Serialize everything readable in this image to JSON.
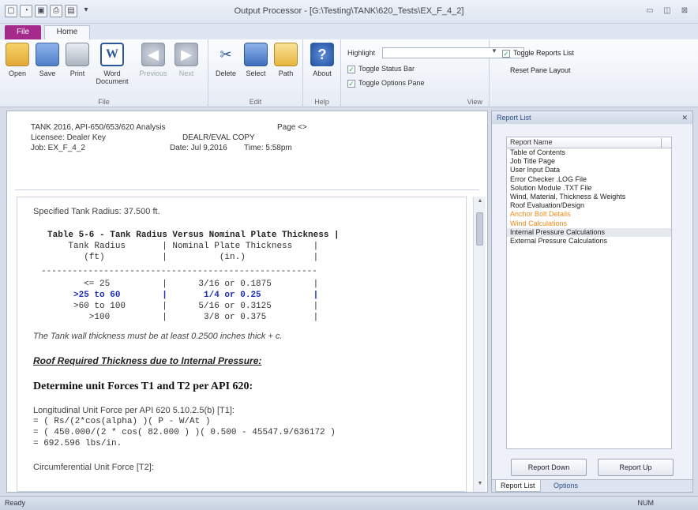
{
  "window": {
    "title": "Output Processor - [G:\\Testing\\TANK\\620_Tests\\EX_F_4_2]"
  },
  "ribbon": {
    "tabs": [
      "File",
      "Home"
    ],
    "file_group": {
      "label": "File",
      "buttons": [
        "Open",
        "Save",
        "Print",
        "Word Document",
        "Previous",
        "Next"
      ]
    },
    "edit_group": {
      "label": "Edit",
      "buttons": [
        "Delete",
        "Select",
        "Path"
      ]
    },
    "help_group": {
      "label": "Help",
      "buttons": [
        "About"
      ]
    },
    "view_group": {
      "label": "View",
      "highlight_label": "Highlight",
      "highlight_value": "",
      "toggle_status_bar": "Toggle Status Bar",
      "toggle_options_pane": "Toggle Options Pane",
      "toggle_reports_list": "Toggle Reports List",
      "reset_pane_layout": "Reset Pane Layout"
    }
  },
  "report_header": {
    "line1": "TANK 2016, API-650/653/620 Analysis",
    "page": "Page <>",
    "licensee": "Licensee: Dealer Key",
    "copy": "DEALR/EVAL COPY",
    "job": "Job: EX_F_4_2",
    "date": "Date: Jul 9,2016",
    "time": "Time: 5:58pm"
  },
  "report_body": {
    "radius_line": "Specified Tank Radius: 37.500 ft.",
    "table_title": "Table 5-6 - Tank Radius Versus Nominal Plate Thickness |",
    "col_head1": "    Tank Radius       | Nominal Plate Thickness    |",
    "col_head2": "       (ft)           |          (in.)             |",
    "divider": "-----------------------------------------------------",
    "row1": "       <= 25          |      3/16 or 0.1875        |",
    "row2": "     >25 to 60        |       1/4 or 0.25          |",
    "row3": "     >60 to 100       |      5/16 or 0.3125        |",
    "row4": "        >100          |       3/8 or 0.375         |",
    "min_thk": "The Tank wall thickness must be at least 0.2500 inches thick + c.",
    "roof_heading": "Roof Required Thickness due to Internal Pressure:",
    "unit_forces_heading": "Determine unit Forces T1 and T2 per API 620:",
    "long_force": "Longitudinal Unit Force per API 620 5.10.2.5(b) [T1]:",
    "eq1": "= ( Rs/(2*cos(alpha) )( P - W/At )",
    "eq2": "= ( 450.000/(2 * cos( 82.000 ) )( 0.500 - 45547.9/636172 )",
    "eq3": "= 692.596 lbs/in.",
    "circ_force": "Circumferential Unit Force [T2]:"
  },
  "report_list": {
    "title": "Report List",
    "column_header": "Report Name",
    "items": [
      {
        "label": "Table of Contents",
        "style": "normal"
      },
      {
        "label": "Job Title Page",
        "style": "normal"
      },
      {
        "label": "User Input Data",
        "style": "normal"
      },
      {
        "label": "Error Checker .LOG File",
        "style": "normal"
      },
      {
        "label": "Solution Module .TXT File",
        "style": "normal"
      },
      {
        "label": "Wind, Material, Thickness & Weights",
        "style": "normal"
      },
      {
        "label": "Roof Evaluation/Design",
        "style": "normal"
      },
      {
        "label": "Anchor Bolt Details",
        "style": "orange"
      },
      {
        "label": "Wind Calculations",
        "style": "orange"
      },
      {
        "label": "Internal Pressure Calculations",
        "style": "selected"
      },
      {
        "label": "External Pressure Calculations",
        "style": "normal"
      }
    ],
    "btn_down": "Report Down",
    "btn_up": "Report Up",
    "tabs": [
      "Report List",
      "Options"
    ]
  },
  "status": {
    "left": "Ready",
    "right": "NUM"
  },
  "colors": {
    "file_tab": "#a62a8c",
    "highlight_blue": "#1f2fb4",
    "orange_item": "#ef8a1a"
  }
}
